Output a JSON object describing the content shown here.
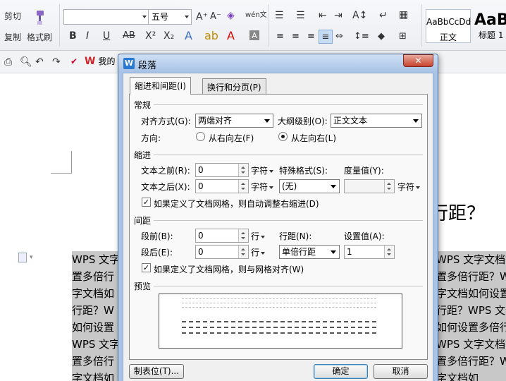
{
  "ribbon": {
    "cut_label": "剪切",
    "copy_label": "复制",
    "format_painter_label": "格式刷",
    "font_size_value": "五号",
    "style_normal_sample": "AaBbCcDd",
    "style_normal_label": "正文",
    "style_heading1_sample": "AaB",
    "style_heading1_label": "标题 1"
  },
  "quickbar": {
    "doc_tab_label": "我的"
  },
  "document": {
    "heading_fragment": "行距？",
    "lines": [
      {
        "left": "WPS 文字",
        "right": "WPS 文字文档如"
      },
      {
        "left": "置多倍行",
        "right": "置多倍行距？W"
      },
      {
        "left": "字文档如",
        "right": "字文档如何设置"
      },
      {
        "left": "行距？W",
        "right": "行距？WPS 文字"
      },
      {
        "left": "如何设置",
        "right": "如何设置多倍行"
      },
      {
        "left": "WPS 文字",
        "right": "WPS 文字文档如"
      },
      {
        "left": "置多倍行",
        "right": "置多倍行距？W"
      },
      {
        "left": "字文档如",
        "right": "字文档如"
      }
    ]
  },
  "dialog": {
    "title": "段落",
    "close_symbol": "✕",
    "tabs": [
      {
        "label": "缩进和间距(I)",
        "active": true
      },
      {
        "label": "换行和分页(P)",
        "active": false
      }
    ],
    "general": {
      "title": "常规",
      "alignment_label": "对齐方式(G):",
      "alignment_value": "两端对齐",
      "outline_label": "大纲级别(O):",
      "outline_value": "正文文本",
      "direction_label": "方向:",
      "rtl_label": "从右向左(F)",
      "ltr_label": "从左向右(L)",
      "ltr_selected": true
    },
    "indent": {
      "title": "缩进",
      "before_label": "文本之前(R):",
      "before_value": "0",
      "before_unit": "字符",
      "after_label": "文本之后(X):",
      "after_value": "0",
      "after_unit": "字符",
      "special_label": "特殊格式(S):",
      "special_value": "(无)",
      "measure_label": "度量值(Y):",
      "measure_value": "",
      "measure_unit": "字符",
      "auto_adjust_label": "如果定义了文档网格，则自动调整右缩进(D)",
      "auto_adjust_checked": true
    },
    "spacing": {
      "title": "间距",
      "before_label": "段前(B):",
      "before_value": "0",
      "before_unit": "行",
      "after_label": "段后(E):",
      "after_value": "0",
      "after_unit": "行",
      "line_spacing_label": "行距(N):",
      "line_spacing_value": "单倍行距",
      "set_value_label": "设置值(A):",
      "set_value_value": "1",
      "snap_grid_label": "如果定义了文档网格，则与网格对齐(W)",
      "snap_grid_checked": true
    },
    "preview": {
      "title": "预览"
    },
    "buttons": {
      "tabs_label": "制表位(T)...",
      "ok_label": "确定",
      "cancel_label": "取消"
    }
  }
}
